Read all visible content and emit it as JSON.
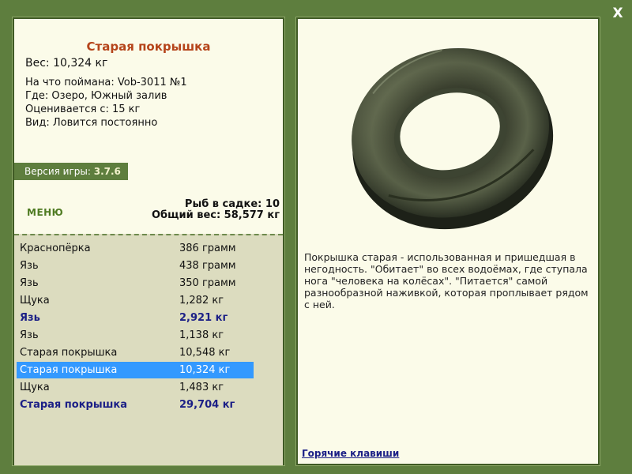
{
  "window": {
    "close_label": "X"
  },
  "fish": {
    "name": "Старая покрышка",
    "weight": "Вес: 10,324 кг",
    "caught_with": "На что поймана: Vob-3011 №1",
    "location": "Где: Озеро, Южный залив",
    "valued_from": "Оценивается с: 15 кг",
    "type": "Вид: Ловится постоянно"
  },
  "version": {
    "label": "Версия игры:",
    "number": "3.7.6"
  },
  "menu_label": "МЕНЮ",
  "keep_net": {
    "count": "Рыб в садке: 10",
    "total_weight": "Общий вес: 58,577 кг"
  },
  "catch_list": [
    {
      "name": "Краснопёрка",
      "weight": "386 грамм",
      "bold": false,
      "selected": false
    },
    {
      "name": "Язь",
      "weight": "438 грамм",
      "bold": false,
      "selected": false
    },
    {
      "name": "Язь",
      "weight": "350 грамм",
      "bold": false,
      "selected": false
    },
    {
      "name": "Щука",
      "weight": "1,282 кг",
      "bold": false,
      "selected": false
    },
    {
      "name": "Язь",
      "weight": "2,921 кг",
      "bold": true,
      "selected": false
    },
    {
      "name": "Язь",
      "weight": "1,138 кг",
      "bold": false,
      "selected": false
    },
    {
      "name": "Старая покрышка",
      "weight": "10,548 кг",
      "bold": false,
      "selected": false
    },
    {
      "name": "Старая покрышка",
      "weight": "10,324 кг",
      "bold": false,
      "selected": true
    },
    {
      "name": "Щука",
      "weight": "1,483 кг",
      "bold": false,
      "selected": false
    },
    {
      "name": "Старая покрышка",
      "weight": "29,704 кг",
      "bold": true,
      "selected": false
    }
  ],
  "description": "Покрышка старая - использованная и пришедшая в негодность. \"Обитает\" во всех водоёмах, где ступала нога \"человека на колёсах\". \"Питается\" самой разнообразной наживкой, которая проплывает рядом с ней.",
  "hotkeys_label": "Горячие клавиши",
  "colors": {
    "background": "#5e7e3e",
    "panel": "#fbfbe9",
    "list_background": "#dcdcbf",
    "title": "#b5441a",
    "highlight": "#1b1f86",
    "selection": "#3399ff"
  }
}
